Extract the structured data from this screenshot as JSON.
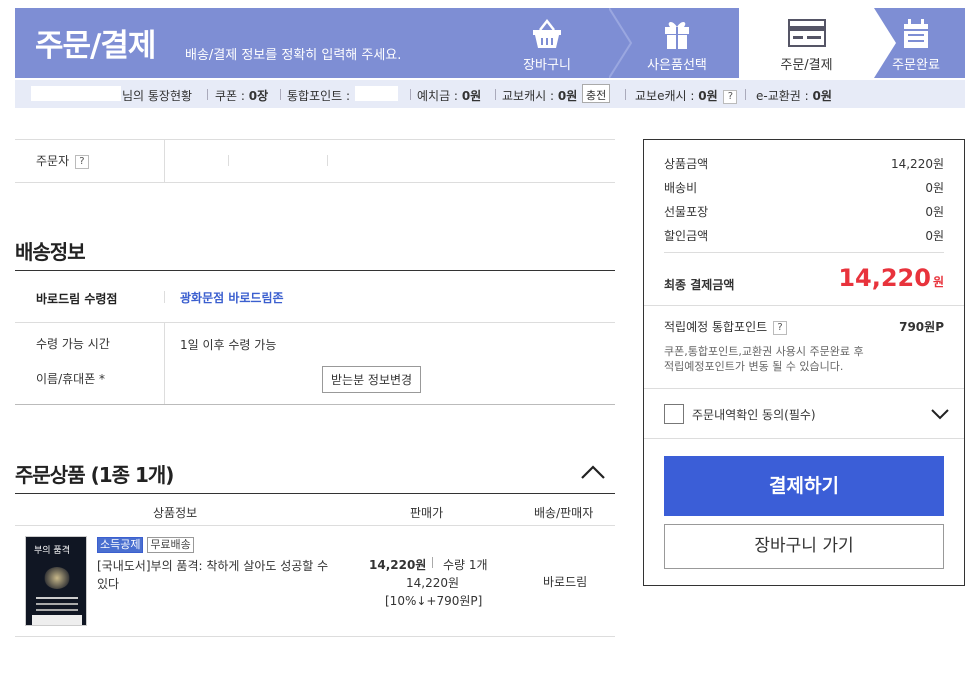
{
  "header": {
    "title": "주문/결제",
    "subtitle": "배송/결제 정보를 정확히 입력해 주세요.",
    "steps": [
      {
        "label": "장바구니",
        "icon": "basket-icon"
      },
      {
        "label": "사은품선택",
        "icon": "gift-icon"
      },
      {
        "label": "주문/결제",
        "icon": "card-icon",
        "active": true
      },
      {
        "label": "주문완료",
        "icon": "calendar-icon"
      }
    ]
  },
  "account": {
    "status_label": "님의 통장현황",
    "coupon_label": "쿠폰 :",
    "coupon_value": "0장",
    "points_label": "통합포인트 :",
    "deposit_label": "예치금 :",
    "deposit_value": "0원",
    "kyobo_cash_label": "교보캐시 :",
    "kyobo_cash_value": "0원",
    "charge_button": "충전",
    "kyobo_ecash_label": "교보e캐시 :",
    "kyobo_ecash_value": "0원",
    "help": "?",
    "ecoupon_label": "e-교환권 :",
    "ecoupon_value": "0원"
  },
  "orderer": {
    "label": "주문자",
    "help": "?"
  },
  "shipping": {
    "title": "배송정보",
    "pickup_label": "바로드림 수령점",
    "pickup_value": "광화문점 바로드림존",
    "time_label": "수령 가능 시간",
    "time_value": "1일 이후 수령 가능",
    "name_label": "이름/휴대폰 *",
    "change_button": "받는분 정보변경"
  },
  "products": {
    "title": "주문상품 (1종 1개)",
    "headers": [
      "상품정보",
      "판매가",
      "배송/판매자"
    ],
    "item": {
      "cover_title": "부의 품격",
      "badge1": "소득공제",
      "badge2": "무료배송",
      "name": "[국내도서]부의 품격: 착하게 살아도 성공할 수 있다",
      "price": "14,220원",
      "qty": "수량 1개",
      "price2": "14,220원",
      "discount": "[10%↓+790원P]",
      "seller": "바로드림"
    }
  },
  "summary": {
    "rows": [
      {
        "label": "상품금액",
        "value": "14,220원"
      },
      {
        "label": "배송비",
        "value": "0원"
      },
      {
        "label": "선물포장",
        "value": "0원"
      },
      {
        "label": "할인금액",
        "value": "0원"
      }
    ],
    "final_label": "최종 결제금액",
    "final_value": "14,220",
    "final_unit": "원",
    "points_label": "적립예정 통합포인트",
    "points_help": "?",
    "points_value": "790원P",
    "notice_line1": "쿠폰,통합포인트,교환권 사용시 주문완료 후",
    "notice_line2": "적립예정포인트가 변동 될 수 있습니다.",
    "agree_label": "주문내역확인 동의(필수)",
    "pay_button": "결제하기",
    "cart_button": "장바구니 가기"
  },
  "colors": {
    "header_bg": "#7e8ed4",
    "accent_blue": "#3b5ed7",
    "price_red": "#e8333c"
  }
}
